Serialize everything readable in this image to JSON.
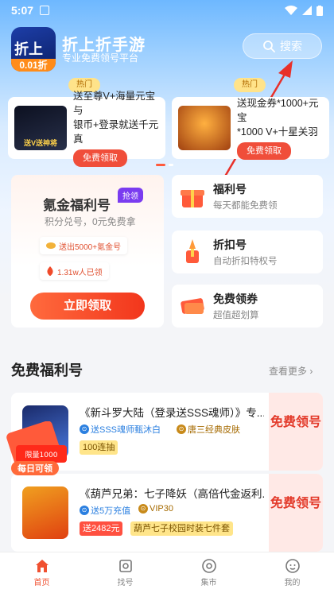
{
  "status": {
    "time": "5:07"
  },
  "header": {
    "logo_top": "折上折",
    "logo_bottom": "0.01折",
    "title": "折上折手游",
    "subtitle": "专业免费领号平台",
    "search_label": "搜索"
  },
  "hot": {
    "badge": "热门",
    "cards": [
      {
        "line1": "送至尊V+海量元宝与",
        "line2": "银币+登录就送千元真",
        "button": "免费领取",
        "img_caption": "送V送神将"
      },
      {
        "line1": "送现金券*1000+元宝",
        "line2": "*1000 V+十星关羽",
        "button": "免费领取"
      }
    ]
  },
  "welfare_card": {
    "title": "氪金福利号",
    "badge": "抢领",
    "subtitle": "积分兑号，0元免费拿",
    "pill1": "送出5000+氪金号",
    "pill2": "1.31w人已领",
    "button": "立即领取"
  },
  "side_cards": [
    {
      "title": "福利号",
      "subtitle": "每天都能免费领"
    },
    {
      "title": "折扣号",
      "subtitle": "自动折扣特权号"
    },
    {
      "title": "免费领券",
      "subtitle": "超值超划算"
    }
  ],
  "free_section": {
    "title": "免费福利号",
    "more": "查看更多"
  },
  "games": [
    {
      "name": "《新斗罗大陆（登录送SSS魂师）》专...",
      "tag1": "送SSS魂师甄沐白",
      "tag2": "唐三经典皮肤",
      "chip1": "100连抽",
      "chip2": "",
      "free": "免费领号"
    },
    {
      "name": "《葫芦兄弟：七子降妖（高倍代金返利...",
      "tag1": "送5万充值",
      "tag2": "VIP30",
      "chip1": "送2482元",
      "chip2": "葫芦七子校园时装七件套",
      "free": "免费领号"
    }
  ],
  "daily_badge": {
    "line1": "限量1000",
    "line2": "每日可领"
  },
  "nav": [
    {
      "label": "首页",
      "icon": "home-icon"
    },
    {
      "label": "找号",
      "icon": "find-icon"
    },
    {
      "label": "集市",
      "icon": "market-icon"
    },
    {
      "label": "我的",
      "icon": "profile-icon"
    }
  ]
}
